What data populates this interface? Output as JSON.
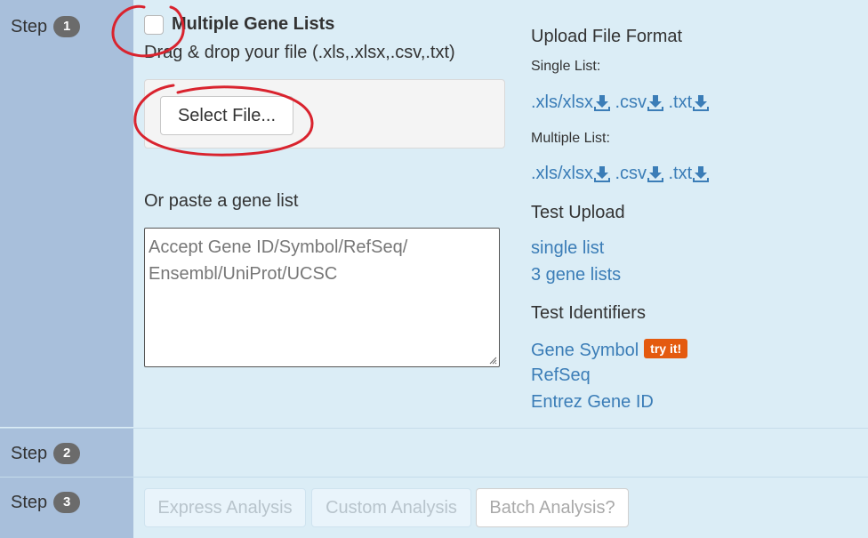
{
  "steps": {
    "step1": {
      "label": "Step",
      "number": "1"
    },
    "step2": {
      "label": "Step",
      "number": "2"
    },
    "step3": {
      "label": "Step",
      "number": "3"
    }
  },
  "upload": {
    "multiple_gene_lists_label": "Multiple Gene Lists",
    "multiple_checked": false,
    "drag_text": "Drag & drop your file (.xls,.xlsx,.csv,.txt)",
    "select_file_label": "Select File...",
    "paste_label": "Or paste a gene list",
    "textarea_placeholder": "Accept Gene ID/Symbol/RefSeq/\nEnsembl/UniProt/UCSC"
  },
  "format": {
    "heading": "Upload File Format",
    "single_label": "Single List:",
    "multiple_label": "Multiple List:",
    "single_links": [
      ".xls/xlsx",
      ".csv",
      ".txt"
    ],
    "multiple_links": [
      ".xls/xlsx",
      ".csv",
      ".txt"
    ],
    "download_icon": "download-icon"
  },
  "test_upload": {
    "heading": "Test Upload",
    "links": [
      "single list",
      "3 gene lists"
    ]
  },
  "test_identifiers": {
    "heading": "Test Identifiers",
    "links": [
      "Gene Symbol",
      "RefSeq",
      "Entrez Gene ID"
    ],
    "try_badge": "try it!"
  },
  "analysis_buttons": {
    "express": "Express Analysis",
    "custom": "Custom Analysis",
    "batch": "Batch Analysis?"
  },
  "colors": {
    "link": "#3b7db7",
    "step_column": "#a8bfdb",
    "panel": "#dbedf6",
    "badge": "#6b6b6b",
    "try_badge": "#e45a0f",
    "annotation": "#d9232e"
  }
}
